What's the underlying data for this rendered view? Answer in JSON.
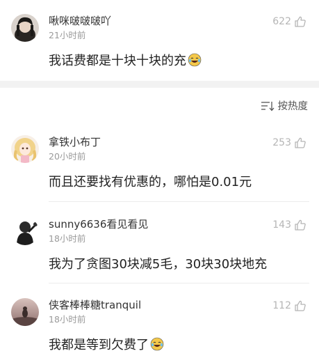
{
  "comments": [
    {
      "username": "啾咪啵啵啵吖",
      "time": "21小时前",
      "likes": "622",
      "text": "我话费都是十块十块的充",
      "emoji": "laughing-crying-emoji"
    },
    {
      "username": "拿铁小布丁",
      "time": "20小时前",
      "likes": "253",
      "text": "而且还要找有优惠的，哪怕是0.01元",
      "emoji": ""
    },
    {
      "username": "sunny6636看见看见",
      "time": "18小时前",
      "likes": "143",
      "text": "我为了贪图30块减5毛，30块30块地充",
      "emoji": ""
    },
    {
      "username": "侠客棒棒糖tranquil",
      "time": "18小时前",
      "likes": "112",
      "text": "我都是等到欠费了",
      "emoji": "laughing-crying-emoji"
    }
  ],
  "sort": {
    "label": "按热度",
    "icon": "sort-icon"
  },
  "colors": {
    "text": "#222222",
    "meta": "#9a9a9a",
    "like": "#b5b5b5",
    "band": "#f2f2f2"
  }
}
